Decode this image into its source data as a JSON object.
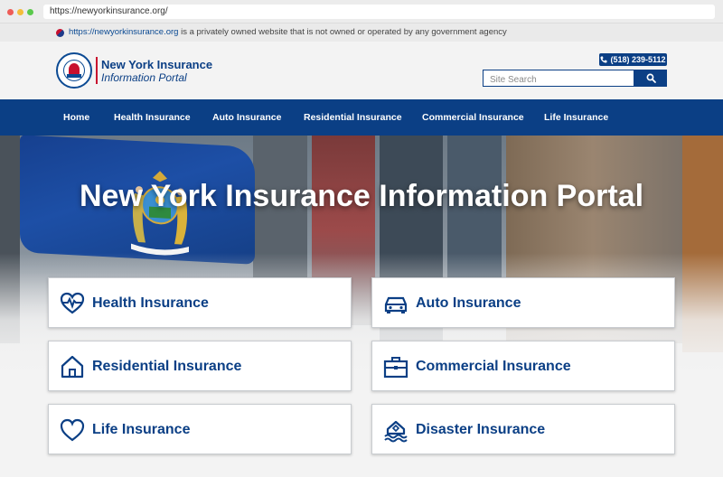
{
  "browser": {
    "url": "https://newyorkinsurance.org/"
  },
  "notice": {
    "link": "https://newyorkinsurance.org",
    "text": " is a privately owned website that is not owned or operated by any government agency"
  },
  "header": {
    "brand_title": "New York Insurance",
    "brand_subtitle": "Information Portal",
    "phone": "(518) 239-5112",
    "search_placeholder": "Site Search"
  },
  "nav": {
    "items": [
      "Home",
      "Health Insurance",
      "Auto Insurance",
      "Residential Insurance",
      "Commercial Insurance",
      "Life Insurance"
    ]
  },
  "hero": {
    "title": "New York Insurance Information Portal"
  },
  "cards": [
    {
      "label": "Health Insurance",
      "icon": "heart-pulse-icon"
    },
    {
      "label": "Auto Insurance",
      "icon": "car-icon"
    },
    {
      "label": "Residential Insurance",
      "icon": "house-icon"
    },
    {
      "label": "Commercial Insurance",
      "icon": "briefcase-icon"
    },
    {
      "label": "Life Insurance",
      "icon": "heart-icon"
    },
    {
      "label": "Disaster Insurance",
      "icon": "house-flood-icon"
    }
  ],
  "colors": {
    "brand_blue": "#0b3f85",
    "accent_red": "#c8102e",
    "page_bg": "#f3f3f3"
  }
}
